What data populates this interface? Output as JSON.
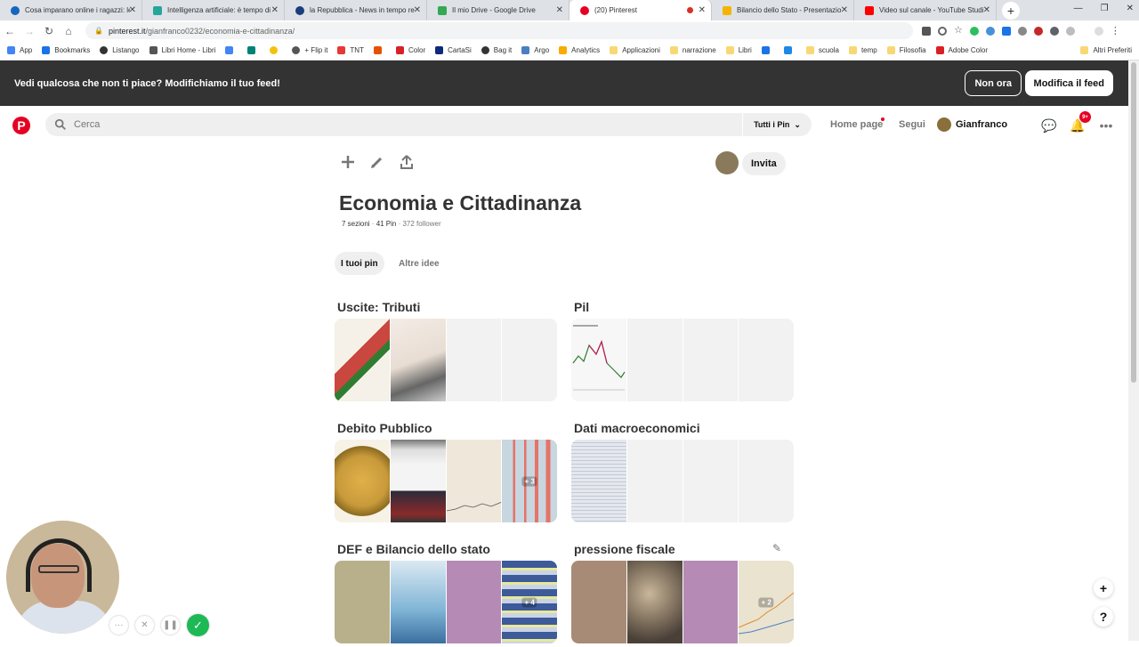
{
  "browser": {
    "tabs": [
      {
        "title": "Cosa imparano online i ragazzi: le",
        "color": "#1565c0"
      },
      {
        "title": "Intelligenza artificiale: è tempo di",
        "color": "#26a69a"
      },
      {
        "title": "la Repubblica - News in tempo re",
        "color": "#1a3d7c"
      },
      {
        "title": "Il mio Drive - Google Drive",
        "color": "#34a853"
      },
      {
        "title": "(20) Pinterest",
        "color": "#e60023"
      },
      {
        "title": "Bilancio dello Stato - Presentazio",
        "color": "#f4b400"
      },
      {
        "title": "Video sul canale - YouTube Studi",
        "color": "#ff0000"
      }
    ],
    "url_host": "pinterest.it",
    "url_path": "/gianfranco0232/economia-e-cittadinanza/",
    "bookmarks": [
      "App",
      "Bookmarks",
      "Listango",
      "Libri Home - Libri",
      "",
      "",
      "",
      "+ Flip it",
      "TNT",
      "",
      "Color",
      "CartaSi",
      "Bag it",
      "Argo",
      "Analytics",
      "Applicazioni",
      "narrazione",
      "Libri",
      "",
      "",
      "scuola",
      "temp",
      "Filosofia",
      "Adobe Color"
    ],
    "bookmarks_other": "Altri Preferiti"
  },
  "banner": {
    "text": "Vedi qualcosa che non ti piace? Modifichiamo il tuo feed!",
    "not_now": "Non ora",
    "edit_feed": "Modifica il feed"
  },
  "header": {
    "search_placeholder": "Cerca",
    "scope": "Tutti i Pin",
    "home": "Home page",
    "following": "Segui",
    "user": "Gianfranco",
    "notifications_badge": "9+"
  },
  "board": {
    "title": "Economia e Cittadinanza",
    "sections_count": "7 sezioni",
    "pins_count": "41 Pin",
    "followers": "372 follower",
    "invite": "Invita",
    "tab_your_pins": "I tuoi pin",
    "tab_more_ideas": "Altre idee"
  },
  "sections": [
    {
      "title": "Uscite: Tributi",
      "thumbs": [
        "#c9473f",
        "#e8ddd3",
        "#f2f2f2",
        "#f2f2f2"
      ]
    },
    {
      "title": "Pil",
      "thumbs": [
        "#eef2ee",
        "#f2f2f2",
        "#f2f2f2",
        "#f2f2f2"
      ]
    },
    {
      "title": "Debito Pubblico",
      "thumbs": [
        "#c99a3a",
        "#3a3a4a",
        "#e9e3d6",
        "#c8d6e0"
      ],
      "more": "+ 3"
    },
    {
      "title": "Dati macroeconomici",
      "thumbs": [
        "#e4e8ee",
        "#f2f2f2",
        "#f2f2f2",
        "#f2f2f2"
      ]
    },
    {
      "title": "DEF e Bilancio dello stato",
      "thumbs": [
        "#b8b08a",
        "#7fb4d6",
        "#b58bb5",
        "#3d5a99"
      ],
      "more": "+ 4"
    },
    {
      "title": "pressione fiscale",
      "thumbs": [
        "#a88b76",
        "#6f6257",
        "#b58bb5",
        "#d9cfb8"
      ],
      "more": "+ 2"
    }
  ]
}
